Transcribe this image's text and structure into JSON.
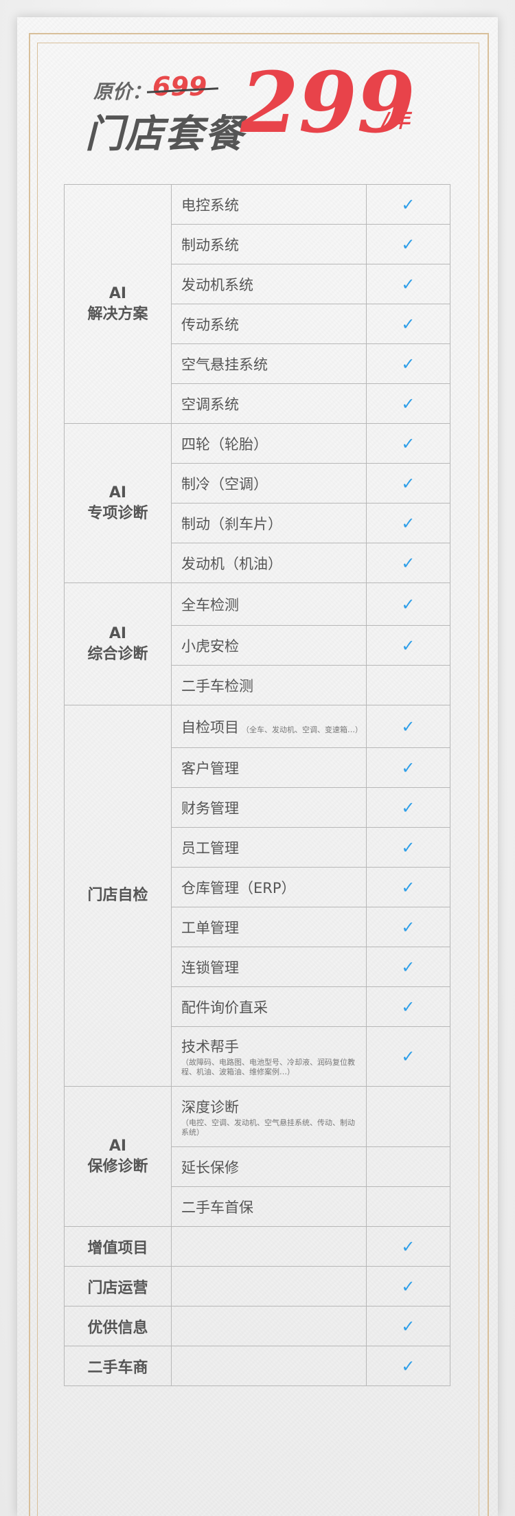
{
  "header": {
    "original_label": "原价：",
    "original_price": "699",
    "package_title": "门店套餐",
    "price": "299",
    "per_year": "/年"
  },
  "check_symbol": "✓",
  "accent_color": "#e8434a",
  "check_color": "#2f9fe8",
  "groups": [
    {
      "name": [
        "AI",
        "解决方案"
      ],
      "items": [
        {
          "label": "电控系统",
          "checked": true
        },
        {
          "label": "制动系统",
          "checked": true
        },
        {
          "label": "发动机系统",
          "checked": true
        },
        {
          "label": "传动系统",
          "checked": true
        },
        {
          "label": "空气悬挂系统",
          "checked": true
        },
        {
          "label": "空调系统",
          "checked": true
        }
      ]
    },
    {
      "name": [
        "AI",
        "专项诊断"
      ],
      "items": [
        {
          "label": "四轮（轮胎）",
          "checked": true
        },
        {
          "label": "制冷（空调）",
          "checked": true
        },
        {
          "label": "制动（刹车片）",
          "checked": true
        },
        {
          "label": "发动机（机油）",
          "checked": true
        }
      ]
    },
    {
      "name": [
        "AI",
        "综合诊断"
      ],
      "items": [
        {
          "label": "全车检测",
          "checked": true
        },
        {
          "label": "小虎安检",
          "checked": true
        },
        {
          "label": "二手车检测",
          "checked": false
        }
      ]
    },
    {
      "name": [
        "门店自检"
      ],
      "items": [
        {
          "label": "自检项目",
          "note": "（全车、发动机、空调、变速箱…）",
          "checked": true
        },
        {
          "label": "客户管理",
          "checked": true
        },
        {
          "label": "财务管理",
          "checked": true
        },
        {
          "label": "员工管理",
          "checked": true
        },
        {
          "label": "仓库管理（ERP）",
          "checked": true
        },
        {
          "label": "工单管理",
          "checked": true
        },
        {
          "label": "连锁管理",
          "checked": true
        },
        {
          "label": "配件询价直采",
          "checked": true
        },
        {
          "label": "技术帮手",
          "note": "（故障码、电路图、电池型号、冷却液、润码复位教程、机油、波箱油、维修案例…）",
          "checked": true
        }
      ]
    },
    {
      "name": [
        "AI",
        "保修诊断"
      ],
      "items": [
        {
          "label": "深度诊断",
          "note": "（电控、空调、发动机、空气悬挂系统、传动、制动系统）",
          "checked": false
        },
        {
          "label": "延长保修",
          "checked": false
        },
        {
          "label": "二手车首保",
          "checked": false
        }
      ]
    }
  ],
  "extras": [
    {
      "label": "增值项目",
      "checked": true
    },
    {
      "label": "门店运营",
      "checked": true
    },
    {
      "label": "优供信息",
      "checked": true
    },
    {
      "label": "二手车商",
      "checked": true
    }
  ]
}
